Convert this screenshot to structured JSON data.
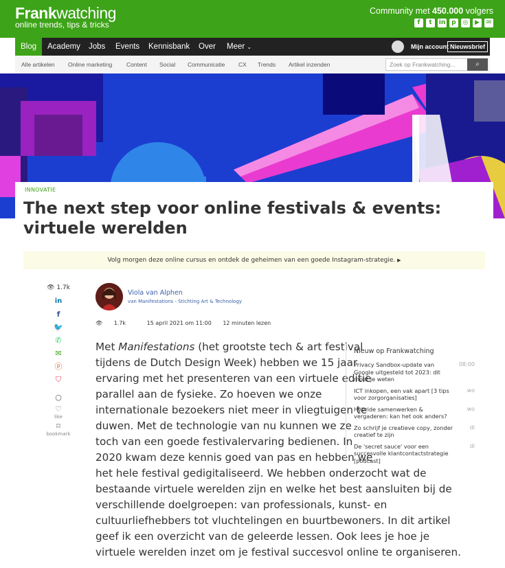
{
  "header": {
    "logo_bold": "Frank",
    "logo_light": "watching",
    "tagline": "online trends, tips & tricks",
    "community_prefix": "Community met ",
    "community_count": "450.000",
    "community_suffix": " volgers",
    "social_icons": [
      "facebook-icon",
      "twitter-icon",
      "linkedin-icon",
      "pinterest-icon",
      "instagram-icon",
      "youtube-icon",
      "email-icon"
    ]
  },
  "nav": {
    "items": [
      "Blog",
      "Academy",
      "Jobs",
      "Events",
      "Kennisbank",
      "Over",
      "Meer"
    ],
    "account": "Mijn account",
    "newsletter": "Nieuwsbrief"
  },
  "subnav": {
    "items": [
      "Alle artikelen",
      "Online marketing",
      "Content",
      "Social",
      "Communicatie",
      "CX",
      "Trends",
      "Artikel inzenden"
    ],
    "search_placeholder": "Zoek op Frankwatching..."
  },
  "article": {
    "category": "INNOVATIE",
    "title": "The next step voor online festivals & events: virtuele werelden",
    "promo": "Volg morgen deze online cursus en ontdek de geheimen van een goede Instagram-strategie.",
    "views": "1.7k",
    "author_name": "Viola van Alphen",
    "author_org": "van Manifestations - Stichting Art & Technology",
    "meta_views": "1.7k",
    "date": "15 april 2021 om 11:00",
    "read_time": "12 minuten lezen",
    "like_label": "like",
    "bookmark_label": "bookmark",
    "body_lines": [
      [
        "Met ",
        "Manifestations",
        " (het grootste tech & art festival"
      ],
      [
        "tijdens de Dutch Design Week) hebben we 15 jaar"
      ],
      [
        "ervaring met het presenteren van een virtuele editie"
      ],
      [
        "parallel aan de fysieke. Zo hoeven we onze"
      ],
      [
        "internationale bezoekers niet meer in vliegtuigen te"
      ],
      [
        "duwen. Met de technologie van nu kunnen we ze"
      ],
      [
        "toch van een goede festivalervaring bedienen. In"
      ],
      [
        "2020 kwam deze kennis goed van pas en hebben we"
      ],
      [
        "het hele festival gedigitaliseerd. We hebben onderzocht wat de"
      ],
      [
        "bestaande virtuele werelden zijn en welke het best aansluiten bij de"
      ],
      [
        "verschillende doelgroepen: van professionals, kunst- en"
      ],
      [
        "cultuurliefhebbers tot vluchtelingen en buurtbewoners. In dit artikel"
      ],
      [
        "geef ik een overzicht van de geleerde lessen. Ook lees je hoe je"
      ],
      [
        "virtuele werelden inzet om je festival succesvol online te organiseren."
      ]
    ]
  },
  "sidebar": {
    "heading": "Nieuw op Frankwatching",
    "items": [
      {
        "title": "Privacy Sandbox-update van Google uitgesteld tot 2023: dit moet je weten",
        "time": "08:00"
      },
      {
        "title": "ICT inkopen, een vak apart [3 tips voor zorgorganisaties]",
        "time": "wo"
      },
      {
        "title": "Hybride samenwerken & vergaderen: kan het ook anders?",
        "time": "wo"
      },
      {
        "title": "Zo schrijf je creatieve copy, zonder creatief te zijn",
        "time": "di"
      },
      {
        "title": "De 'secret sauce' voor een succesvolle klantcontactstrategie [podcast]",
        "time": "di"
      }
    ]
  },
  "colors": {
    "brand_green": "#3da318",
    "nav_dark": "#222222",
    "link_blue": "#3a5fa8"
  }
}
